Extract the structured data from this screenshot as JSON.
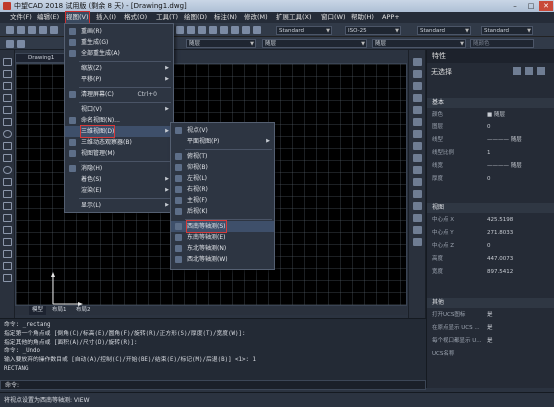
{
  "window": {
    "title": "中望CAD 2018 试用版 (剩余 8 天) - [Drawing1.dwg]",
    "min": "–",
    "max": "□",
    "close": "✕"
  },
  "menubar": [
    "文件(F)",
    "编辑(E)",
    "视图(V)",
    "插入(I)",
    "格式(O)",
    "工具(T)",
    "绘图(D)",
    "标注(N)",
    "修改(M)",
    "扩展工具(X)",
    "窗口(W)",
    "帮助(H)",
    "APP+"
  ],
  "toolbar": {
    "text_style": "Standard",
    "dim_style": "ISO-25",
    "table_style": "Standard",
    "multileader_style": "Standard",
    "layer": "0",
    "color": "随层",
    "linetype": "随层",
    "lineweight": "随层",
    "plot_style": "随颜色"
  },
  "drawing_tab": "Drawing1",
  "view_menu": {
    "items": [
      {
        "label": "重画(R)",
        "shortcut": "",
        "submenu": false
      },
      {
        "label": "重生成(G)",
        "shortcut": "",
        "submenu": false
      },
      {
        "label": "全部重生成(A)",
        "shortcut": "",
        "submenu": false
      },
      {
        "label": "缩放(Z)",
        "shortcut": "",
        "submenu": true
      },
      {
        "label": "平移(P)",
        "shortcut": "",
        "submenu": true
      },
      {
        "label": "清理屏幕(C)",
        "shortcut": "Ctrl+0",
        "submenu": false
      },
      {
        "label": "视口(V)",
        "shortcut": "",
        "submenu": true
      },
      {
        "label": "命名视图(N)...",
        "shortcut": "",
        "submenu": false
      },
      {
        "label": "三维视图(D)",
        "shortcut": "",
        "submenu": true
      },
      {
        "label": "三维动态观察器(B)",
        "shortcut": "",
        "submenu": false
      },
      {
        "label": "视图管理(M)",
        "shortcut": "",
        "submenu": false
      },
      {
        "label": "消隐(H)",
        "shortcut": "",
        "submenu": false
      },
      {
        "label": "着色(S)",
        "shortcut": "",
        "submenu": true
      },
      {
        "label": "渲染(E)",
        "shortcut": "",
        "submenu": true
      },
      {
        "label": "显示(L)",
        "shortcut": "",
        "submenu": true
      }
    ]
  },
  "view3d_menu": {
    "items": [
      {
        "label": "视点(V)",
        "submenu": false
      },
      {
        "label": "平面视图(P)",
        "submenu": true
      },
      {
        "label": "俯视(T)",
        "submenu": false
      },
      {
        "label": "仰视(B)",
        "submenu": false
      },
      {
        "label": "左视(L)",
        "submenu": false
      },
      {
        "label": "右视(R)",
        "submenu": false
      },
      {
        "label": "主视(F)",
        "submenu": false
      },
      {
        "label": "后视(K)",
        "submenu": false
      },
      {
        "label": "西南等轴测(S)",
        "submenu": false
      },
      {
        "label": "东南等轴测(E)",
        "submenu": false
      },
      {
        "label": "东北等轴测(N)",
        "submenu": false
      },
      {
        "label": "西北等轴测(W)",
        "submenu": false
      }
    ]
  },
  "properties": {
    "title": "特性",
    "selection": "无选择",
    "sections": {
      "basic": "基本",
      "view": "视图",
      "misc": "其他"
    },
    "basic_rows": [
      {
        "k": "颜色",
        "v": "■ 随层"
      },
      {
        "k": "图层",
        "v": "0"
      },
      {
        "k": "线型",
        "v": "———— 随层"
      },
      {
        "k": "线型比例",
        "v": "1"
      },
      {
        "k": "线宽",
        "v": "———— 随层"
      },
      {
        "k": "厚度",
        "v": "0"
      }
    ],
    "view_rows": [
      {
        "k": "中心点 X",
        "v": "425.5198"
      },
      {
        "k": "中心点 Y",
        "v": "271.8033"
      },
      {
        "k": "中心点 Z",
        "v": "0"
      },
      {
        "k": "高度",
        "v": "447.0073"
      },
      {
        "k": "宽度",
        "v": "897.5412"
      }
    ],
    "misc_rows": [
      {
        "k": "打开UCS图标",
        "v": "是"
      },
      {
        "k": "在原点显示 UCS ...",
        "v": "是"
      },
      {
        "k": "每个视口都显示 U...",
        "v": "是"
      },
      {
        "k": "UCS名称",
        "v": ""
      }
    ]
  },
  "layout_tabs": [
    "模型",
    "布局1",
    "布局2"
  ],
  "command_history": [
    "命令: _rectang",
    "指定第一个角点或 [倒角(C)/标高(E)/圆角(F)/旋转(R)/正方形(S)/厚度(T)/宽度(W)]:",
    "指定其他的角点或 [面积(A)/尺寸(D)/旋转(R)]:",
    "命令: _Undo",
    "输入要放弃的操作数目或 [自动(A)/控制(C)/开始(BE)/结束(E)/标记(M)/后退(B)] <1>: 1",
    "RECTANG"
  ],
  "command_prompt": "命令:",
  "status_text": "将视点设置为西南等轴测: VIEW"
}
